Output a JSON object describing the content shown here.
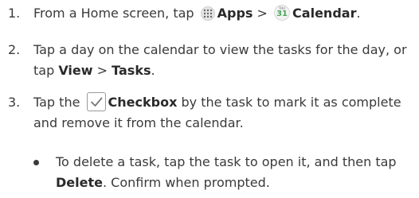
{
  "steps": [
    {
      "number": "1.",
      "prefix": "From a Home screen, tap",
      "apps_label": "Apps",
      "separator": ">",
      "calendar_icon_day": "THU",
      "calendar_icon_number": "31",
      "calendar_label": "Calendar",
      "suffix": "."
    },
    {
      "number": "2.",
      "prefix": "Tap a day on the calendar to view the tasks for the day, or tap",
      "view_label": "View",
      "separator": ">",
      "tasks_label": "Tasks",
      "suffix": "."
    },
    {
      "number": "3.",
      "prefix": "Tap the",
      "checkbox_label": "Checkbox",
      "suffix": "by the task to mark it as complete and remove it from the calendar."
    }
  ],
  "bullets": [
    {
      "prefix": "To delete a task, tap the task to open it, and then tap",
      "delete_label": "Delete",
      "suffix": ". Confirm when prompted."
    }
  ],
  "icons": {
    "apps": "apps-grid-icon",
    "calendar": "calendar-icon",
    "checkbox": "checkbox-icon"
  },
  "colors": {
    "text": "#3a3a3a",
    "calendar_accent": "#4aa55b"
  }
}
